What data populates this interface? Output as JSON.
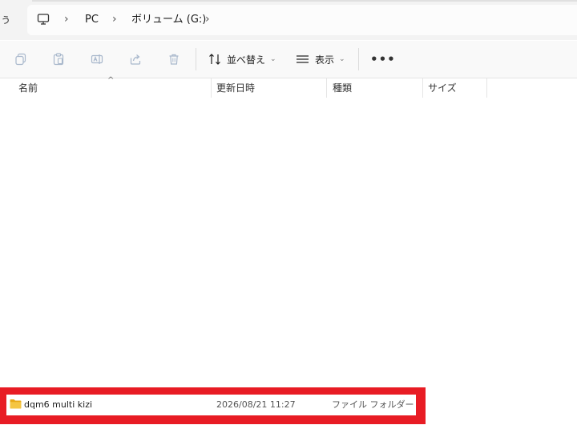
{
  "address_bar": {
    "refresh_glyph": "ぅ",
    "breadcrumbs": [
      "PC",
      "ボリューム (G:)"
    ],
    "separator": "›"
  },
  "toolbar": {
    "icons": [
      "copy-icon",
      "paste-icon",
      "rename-icon",
      "share-icon",
      "delete-icon"
    ],
    "sort_label": "並べ替え",
    "view_label": "表示",
    "more_label": "•••"
  },
  "columns": {
    "name": "名前",
    "modified": "更新日時",
    "type": "種類",
    "size": "サイズ"
  },
  "files": [
    {
      "icon": "folder-icon",
      "name": "dqm6 multi kizi",
      "modified": "2026/08/21 11:27",
      "type": "ファイル フォルダー",
      "size": ""
    }
  ],
  "colors": {
    "highlight": "#e81c24",
    "folder": "#f4c542",
    "toolbar_bg": "#f9f9f9",
    "address_bg": "#f3f3f3"
  }
}
